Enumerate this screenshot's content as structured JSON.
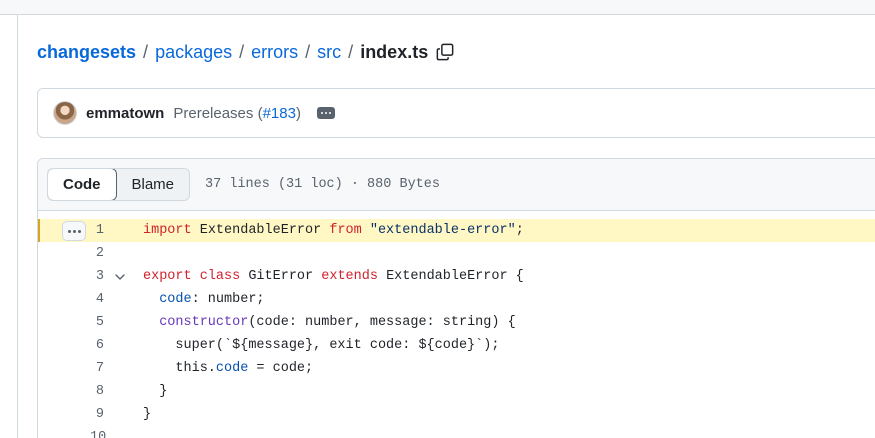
{
  "breadcrumb": {
    "root": "changesets",
    "parts": [
      "packages",
      "errors",
      "src"
    ],
    "separator": "/",
    "current": "index.ts"
  },
  "commit": {
    "author": "emmatown",
    "message": "Prereleases (",
    "pr_link": "#183",
    "message_end": ")"
  },
  "code_view": {
    "tabs": [
      "Code",
      "Blame"
    ],
    "active_tab": "Code",
    "file_meta": "37 lines (31 loc) · 880 Bytes"
  },
  "code": {
    "lines": [
      {
        "num": "1",
        "tokens": [
          {
            "t": "import ",
            "c": "k"
          },
          {
            "t": "ExtendableError ",
            "c": ""
          },
          {
            "t": "from ",
            "c": "k"
          },
          {
            "t": "\"extendable-error\"",
            "c": "s"
          },
          {
            "t": ";",
            "c": ""
          }
        ]
      },
      {
        "num": "2",
        "tokens": []
      },
      {
        "num": "3",
        "tokens": [
          {
            "t": "export ",
            "c": "k"
          },
          {
            "t": "class ",
            "c": "k"
          },
          {
            "t": "GitError ",
            "c": ""
          },
          {
            "t": "extends ",
            "c": "k"
          },
          {
            "t": "ExtendableError {",
            "c": ""
          }
        ]
      },
      {
        "num": "4",
        "tokens": [
          {
            "t": "  ",
            "c": ""
          },
          {
            "t": "code",
            "c": "p"
          },
          {
            "t": ": number;",
            "c": ""
          }
        ]
      },
      {
        "num": "5",
        "tokens": [
          {
            "t": "  ",
            "c": ""
          },
          {
            "t": "constructor",
            "c": "f"
          },
          {
            "t": "(code: number, message: string) {",
            "c": ""
          }
        ]
      },
      {
        "num": "6",
        "tokens": [
          {
            "t": "    super(`${message}, exit code: ${code}`);",
            "c": ""
          }
        ]
      },
      {
        "num": "7",
        "tokens": [
          {
            "t": "    this.",
            "c": ""
          },
          {
            "t": "code",
            "c": "p"
          },
          {
            "t": " = code;",
            "c": ""
          }
        ]
      },
      {
        "num": "8",
        "tokens": [
          {
            "t": "  }",
            "c": ""
          }
        ]
      },
      {
        "num": "9",
        "tokens": [
          {
            "t": "}",
            "c": ""
          }
        ]
      },
      {
        "num": "10",
        "tokens": []
      }
    ]
  },
  "colors": {
    "link": "#0969da",
    "keyword": "#cf222e",
    "string": "#0a3069",
    "property": "#0550ae",
    "function": "#6639ba",
    "highlight": "#fff8c5"
  },
  "icons": {
    "copy": "copy-icon",
    "commit_options": "kebab-horizontal-icon",
    "line_options": "kebab-horizontal-icon",
    "fold": "chevron-down-icon"
  }
}
